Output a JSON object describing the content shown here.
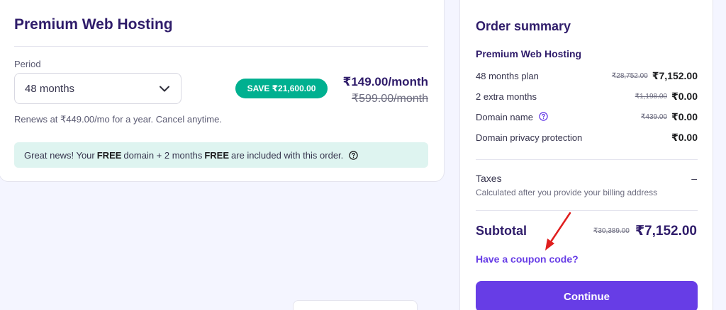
{
  "colors": {
    "brand": "#673de6",
    "heading": "#2f1c6a",
    "save_badge": "#00b090",
    "banner_bg": "#def4f0",
    "annotation_arrow": "#e01e1e"
  },
  "plan_card": {
    "title": "Premium Web Hosting",
    "period_label": "Period",
    "period_selected": "48 months",
    "save_badge": "SAVE ₹21,600.00",
    "price_current": "₹149.00/month",
    "price_old": "₹599.00/month",
    "renew_text": "Renews at ₹449.00/mo for a year. Cancel anytime.",
    "banner": {
      "text_1": "Great news! Your",
      "bold_1": "FREE",
      "text_2": "domain + 2 months",
      "bold_2": "FREE",
      "text_3": "are included with this order.",
      "icon": "help-icon"
    }
  },
  "summary": {
    "title": "Order summary",
    "product": "Premium Web Hosting",
    "items": [
      {
        "label": "48 months plan",
        "old": "₹28,752.00",
        "new": "₹7,152.00"
      },
      {
        "label": "2 extra months",
        "old": "₹1,198.00",
        "new": "₹0.00"
      },
      {
        "label": "Domain name",
        "old": "₹439.00",
        "new": "₹0.00",
        "icon": "help-icon"
      },
      {
        "label": "Domain privacy protection",
        "old": "",
        "new": "₹0.00"
      }
    ],
    "taxes_label": "Taxes",
    "taxes_value": "–",
    "taxes_note": "Calculated after you provide your billing address",
    "subtotal_label": "Subtotal",
    "subtotal_old": "₹30,389.00",
    "subtotal_new": "₹7,152.00",
    "coupon_link": "Have a coupon code?",
    "continue_button": "Continue"
  }
}
